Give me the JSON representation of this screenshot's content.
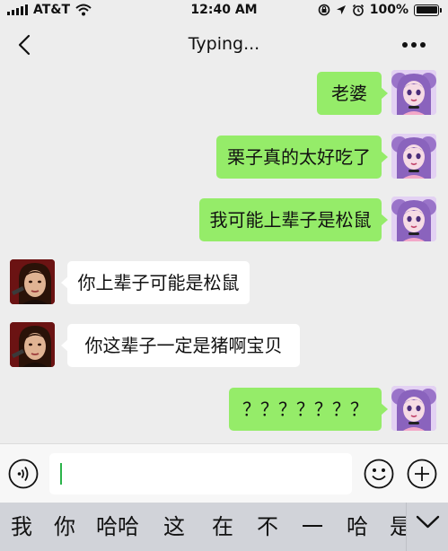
{
  "status_bar": {
    "carrier": "AT&T",
    "time": "12:40 AM",
    "battery": "100%",
    "battery_level": 1.0,
    "icons": [
      "signal-bars-icon",
      "wifi-icon",
      "screen-lock-icon",
      "location-icon",
      "alarm-icon",
      "battery-icon"
    ]
  },
  "nav": {
    "title": "Typing...",
    "back_icon": "chevron-left-icon",
    "more_icon": "more-dots-icon"
  },
  "messages": [
    {
      "sender": "me",
      "text": "老婆"
    },
    {
      "sender": "me",
      "text": "栗子真的太好吃了"
    },
    {
      "sender": "me",
      "text": "我可能上辈子是松鼠"
    },
    {
      "sender": "her",
      "text": "你上辈子可能是松鼠"
    },
    {
      "sender": "her",
      "text": "你这辈子一定是猪啊宝贝"
    },
    {
      "sender": "me",
      "text": "？？？？？？？"
    }
  ],
  "input_bar": {
    "value": "",
    "voice_icon": "voice-icon",
    "emoji_icon": "emoji-icon",
    "add_icon": "plus-icon"
  },
  "keyboard": {
    "candidates": [
      "我",
      "你",
      "哈哈",
      "这",
      "在",
      "不",
      "一",
      "哈",
      "是"
    ],
    "toggle_icon": "chevron-down-icon"
  },
  "colors": {
    "chat_background": "#ededed",
    "my_bubble": "#95ec69",
    "her_bubble": "#ffffff",
    "candidate_bar": "#d1d3d9"
  }
}
